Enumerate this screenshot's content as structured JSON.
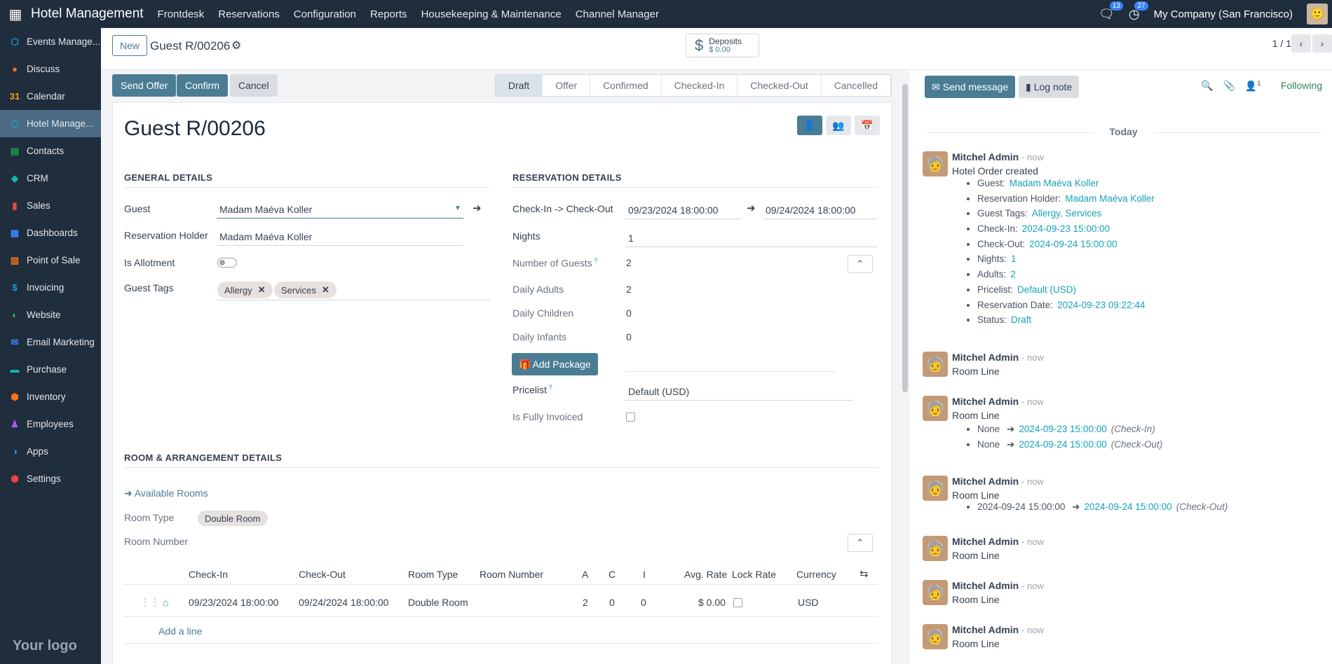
{
  "topbar": {
    "brand": "Hotel Management",
    "menu": [
      "Frontdesk",
      "Reservations",
      "Configuration",
      "Reports",
      "Housekeeping & Maintenance",
      "Channel Manager"
    ],
    "messages_count": "13",
    "activities_count": "27",
    "company": "My Company (San Francisco)"
  },
  "sidebar": {
    "items": [
      {
        "label": "Events Manage...",
        "color": "#1e9bd7"
      },
      {
        "label": "Discuss",
        "color": "#f97316"
      },
      {
        "label": "Calendar",
        "color": "#f59e0b"
      },
      {
        "label": "Hotel Manage...",
        "color": "#1e9bd7"
      },
      {
        "label": "Contacts",
        "color": "#16a34a"
      },
      {
        "label": "CRM",
        "color": "#14b8a6"
      },
      {
        "label": "Sales",
        "color": "#ef4444"
      },
      {
        "label": "Dashboards",
        "color": "#3b82f6"
      },
      {
        "label": "Point of Sale",
        "color": "#f97316"
      },
      {
        "label": "Invoicing",
        "color": "#0ea5e9"
      },
      {
        "label": "Website",
        "color": "#22c55e"
      },
      {
        "label": "Email Marketing",
        "color": "#3b82f6"
      },
      {
        "label": "Purchase",
        "color": "#14b8a6"
      },
      {
        "label": "Inventory",
        "color": "#f97316"
      },
      {
        "label": "Employees",
        "color": "#a855f7"
      },
      {
        "label": "Apps",
        "color": "#3b82f6"
      },
      {
        "label": "Settings",
        "color": "#ef4444"
      }
    ],
    "logo": "Your logo"
  },
  "control": {
    "new_label": "New",
    "record_name": "Guest R/00206",
    "deposits_label": "Deposits",
    "deposits_value": "$ 0.00",
    "pager": "1 / 1"
  },
  "actions": {
    "send_offer": "Send Offer",
    "confirm": "Confirm",
    "cancel": "Cancel"
  },
  "stages": [
    "Draft",
    "Offer",
    "Confirmed",
    "Checked-In",
    "Checked-Out",
    "Cancelled"
  ],
  "form": {
    "title": "Guest R/00206",
    "general_title": "GENERAL DETAILS",
    "guest_label": "Guest",
    "guest_value": "Madam Maéva Koller",
    "holder_label": "Reservation Holder",
    "holder_value": "Madam Maéva Koller",
    "allotment_label": "Is Allotment",
    "tags_label": "Guest Tags",
    "tags": [
      "Allergy",
      "Services"
    ],
    "reservation_title": "RESERVATION DETAILS",
    "checkin_label": "Check-In -> Check-Out",
    "checkin_value": "09/23/2024 18:00:00",
    "checkout_value": "09/24/2024 18:00:00",
    "nights_label": "Nights",
    "nights_value": "1",
    "guests_label": "Number of Guests",
    "guests_value": "2",
    "adults_label": "Daily Adults",
    "adults_value": "2",
    "children_label": "Daily Children",
    "children_value": "0",
    "infants_label": "Daily Infants",
    "infants_value": "0",
    "add_package": "Add Package",
    "pricelist_label": "Pricelist",
    "pricelist_value": "Default (USD)",
    "invoiced_label": "Is Fully Invoiced",
    "room_title": "ROOM & ARRANGEMENT DETAILS",
    "available_rooms": "Available Rooms",
    "room_type_label": "Room Type",
    "room_type_value": "Double Room",
    "room_number_label": "Room Number"
  },
  "table": {
    "headers": [
      "Check-In",
      "Check-Out",
      "Room Type",
      "Room Number",
      "A",
      "C",
      "I",
      "Avg. Rate",
      "Lock Rate",
      "Currency"
    ],
    "row": {
      "checkin": "09/23/2024 18:00:00",
      "checkout": "09/24/2024 18:00:00",
      "room_type": "Double Room",
      "a": "2",
      "c": "0",
      "i": "0",
      "rate": "$ 0.00",
      "currency": "USD"
    },
    "add_line": "Add a line"
  },
  "chatter": {
    "send_message": "Send message",
    "log_note": "Log note",
    "followers": "1",
    "following": "Following",
    "today": "Today",
    "author": "Mitchel Admin",
    "time": "- now",
    "first_body": "Hotel Order created",
    "first_list": [
      {
        "k": "Guest:",
        "v": "Madam Maéva Koller"
      },
      {
        "k": "Reservation Holder:",
        "v": "Madam Maéva Koller"
      },
      {
        "k": "Guest Tags:",
        "v": "Allergy, Services"
      },
      {
        "k": "Check-In:",
        "v": "2024-09-23 15:00:00"
      },
      {
        "k": "Check-Out:",
        "v": "2024-09-24 15:00:00"
      },
      {
        "k": "Nights:",
        "v": "1"
      },
      {
        "k": "Adults:",
        "v": "2"
      },
      {
        "k": "Pricelist:",
        "v": "Default (USD)"
      },
      {
        "k": "Reservation Date:",
        "v": "2024-09-23 09:22:44"
      },
      {
        "k": "Status:",
        "v": "Draft"
      }
    ],
    "room_line": "Room Line",
    "msg3_list": [
      {
        "k": "None",
        "v": "2024-09-23 15:00:00",
        "note": "(Check-In)"
      },
      {
        "k": "None",
        "v": "2024-09-24 15:00:00",
        "note": "(Check-Out)"
      }
    ],
    "msg4_list": [
      {
        "k": "2024-09-24 15:00:00",
        "v": "2024-09-24 15:00:00",
        "note": "(Check-Out)"
      }
    ]
  }
}
